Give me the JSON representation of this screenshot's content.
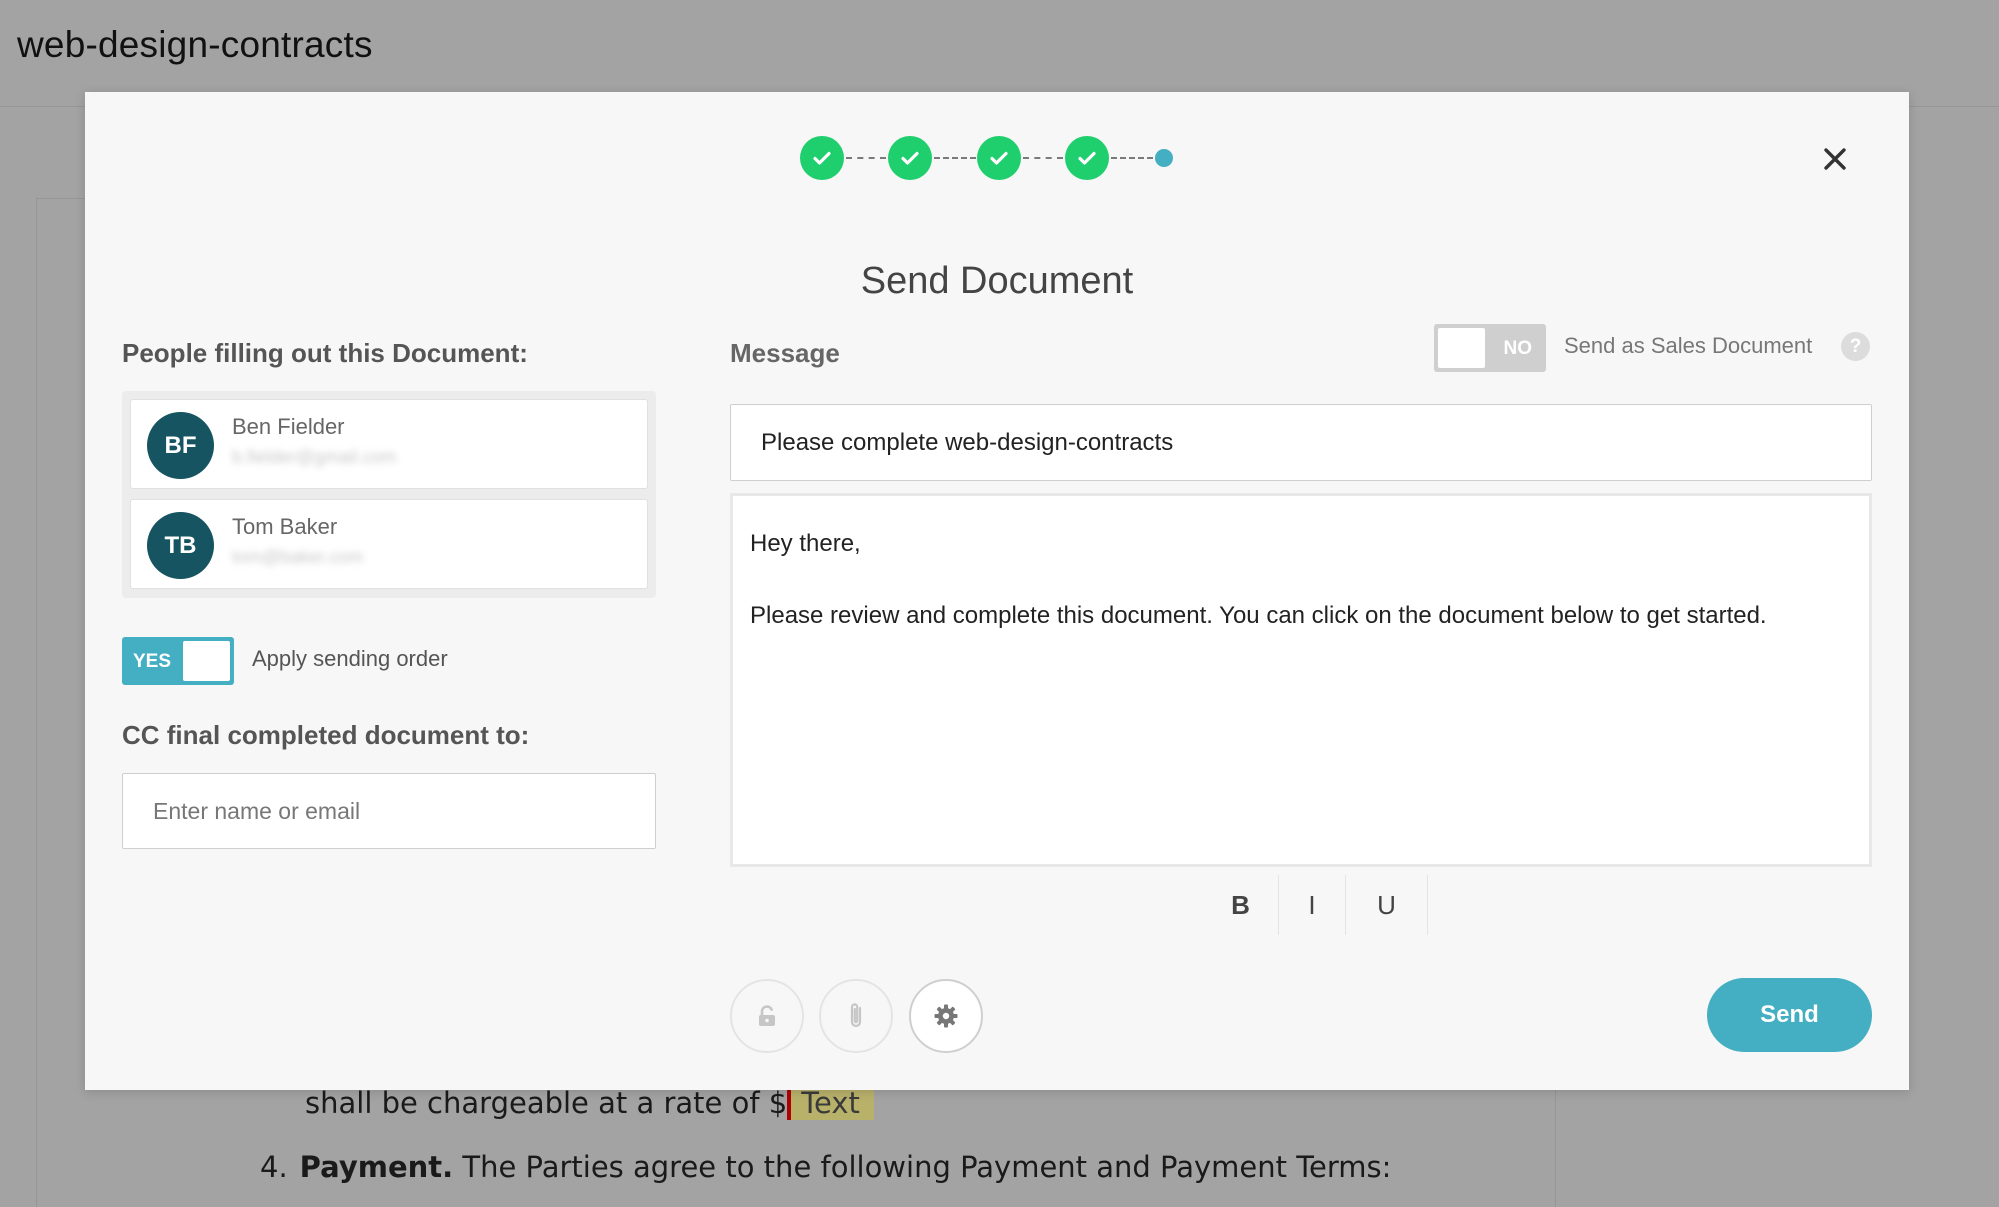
{
  "app": {
    "title": "web-design-contracts"
  },
  "document": {
    "line1_text": "shall be chargeable at a rate of $",
    "line1_field": "Text",
    "line2_number": "4.",
    "line2_bold": "Payment.",
    "line2_text": " The Parties agree to the following Payment and Payment Terms:"
  },
  "modal": {
    "title": "Send Document",
    "steps": {
      "completed": 4,
      "total": 5
    },
    "left": {
      "people_label": "People filling out this Document:",
      "people": [
        {
          "initials": "BF",
          "name": "Ben Fielder",
          "email": "b.fielder@gmail.com"
        },
        {
          "initials": "TB",
          "name": "Tom Baker",
          "email": "tom@baker.com"
        }
      ],
      "sending_order_toggle": "YES",
      "sending_order_label": "Apply sending order",
      "cc_label": "CC final completed document to:",
      "cc_placeholder": "Enter name or email"
    },
    "right": {
      "message_label": "Message",
      "sales_toggle": "NO",
      "sales_label": "Send as Sales Document",
      "help_glyph": "?",
      "subject_value": "Please complete web-design-contracts",
      "body_lines": [
        "Hey there,",
        "Please review and complete this document. You can click on the document below to get started."
      ],
      "format": {
        "bold": "B",
        "italic": "I",
        "underline": "U"
      },
      "send_label": "Send"
    },
    "icons": [
      "check-icon",
      "close-icon",
      "help-icon",
      "lock-icon",
      "paperclip-icon",
      "gear-icon"
    ],
    "colors": {
      "step_done": "#1fce6d",
      "step_current": "#44aec2",
      "accent": "#44aec2",
      "avatar": "#155460"
    }
  }
}
